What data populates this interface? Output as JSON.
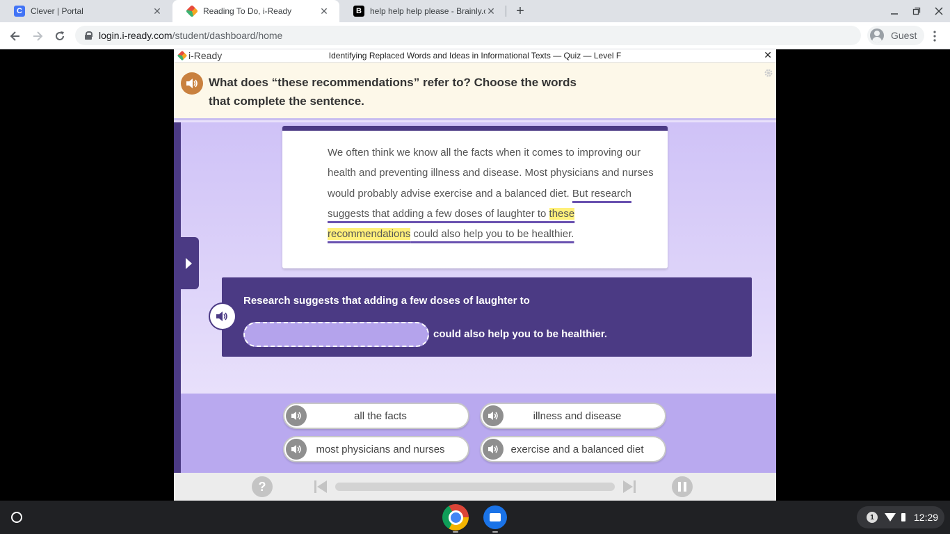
{
  "browser": {
    "tabs": [
      {
        "title": "Clever | Portal",
        "favicon": "C",
        "favicon_color": "#4274f6"
      },
      {
        "title": "Reading To Do, i-Ready",
        "favicon": "",
        "favicon_color": "#f5a623"
      },
      {
        "title": "help help help please - Brainly.co",
        "favicon": "B",
        "favicon_color": "#000000"
      }
    ],
    "close_glyph": "✕",
    "new_tab_glyph": "+",
    "url": {
      "host": "login.i-ready.com",
      "path": "/student/dashboard/home"
    },
    "profile_label": "Guest"
  },
  "app": {
    "logo_text": "i-Ready",
    "title": "Identifying Replaced Words and Ideas in Informational Texts — Quiz — Level F",
    "close_glyph": "✕",
    "question": "What does “these recommendations” refer to? Choose the words that complete the sentence.",
    "passage": {
      "plain": "We often think we know all the facts when it comes to improving our health and preventing illness and disease. Most physicians and nurses would probably advise exercise and a balanced diet. ",
      "underlined_before": "But research suggests that adding a few doses of laughter to ",
      "highlight": "these recommendations",
      "underlined_after": " could also help you to be healthier."
    },
    "sentence": {
      "line1": "Research suggests that adding a few doses of laughter to",
      "line2": "could also help you to be healthier."
    },
    "answers": [
      {
        "label": "all the facts"
      },
      {
        "label": "illness and disease"
      },
      {
        "label": "most physicians and nurses"
      },
      {
        "label": "exercise and a balanced diet"
      }
    ],
    "help_glyph": "?"
  },
  "shelf": {
    "notification_count": "1",
    "time": "12:29"
  },
  "colors": {
    "accent_purple": "#4b3a84",
    "highlight_yellow": "#fff07a",
    "question_bg": "#fdf8e9"
  }
}
